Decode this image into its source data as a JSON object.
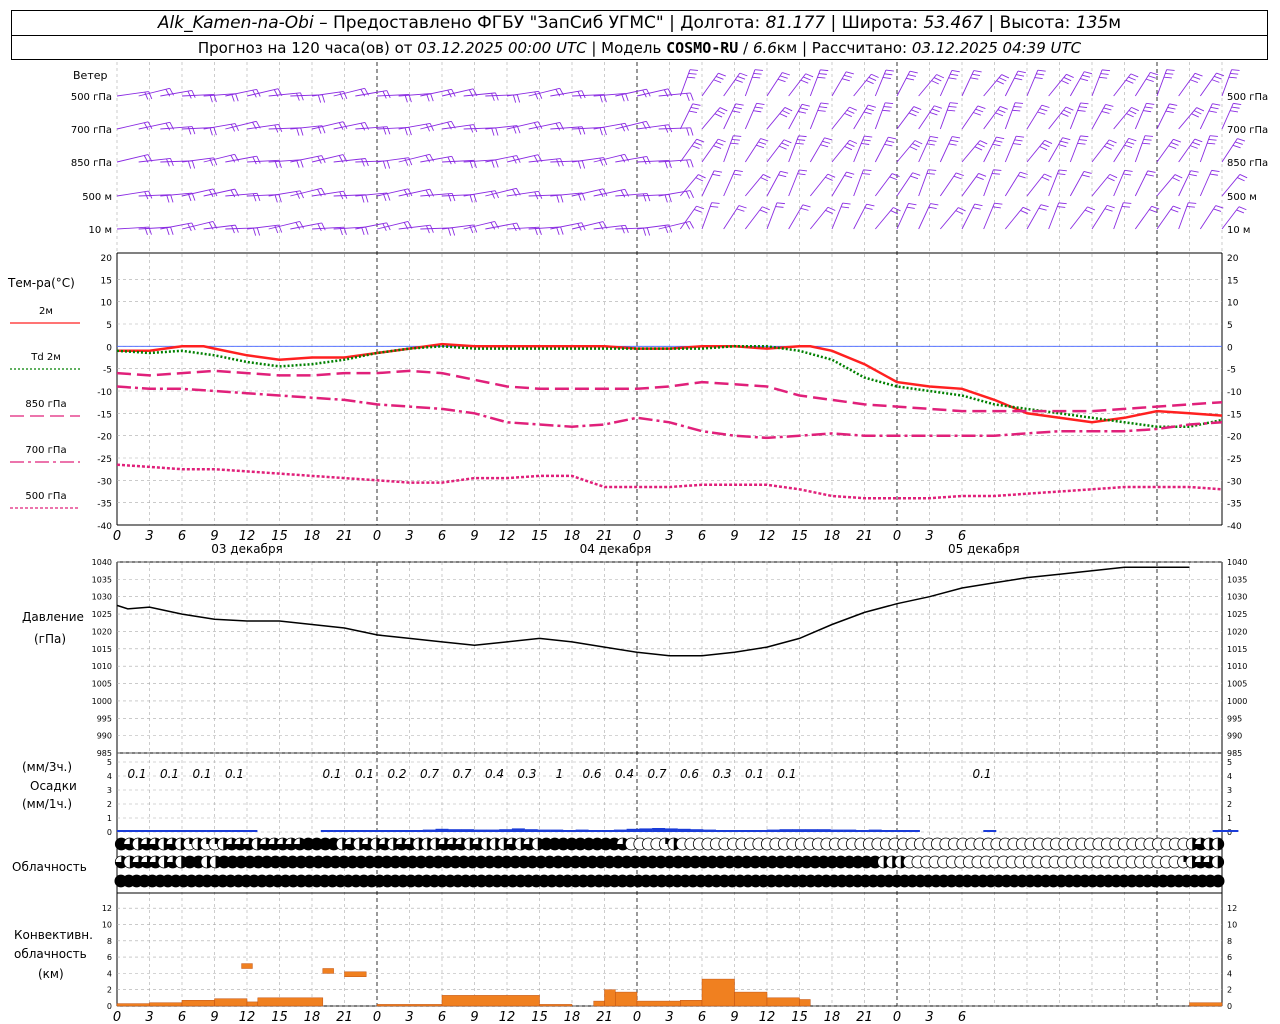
{
  "header": {
    "station": "Alk_Kamen-na-Obi",
    "provider": "– Предоставлено ФГБУ \"ЗапСиб УГМС\"",
    "lon_label": "Долгота:",
    "lon": "81.177",
    "lat_label": "Широта:",
    "lat": "53.467",
    "alt_label": "Высота:",
    "alt": "135",
    "alt_unit": "м",
    "forecast_label": "Прогноз на 120 часа(ов) от",
    "forecast_from": "03.12.2025 00:00 UTC",
    "model_label": "Модель",
    "model": "COSMO-RU",
    "model_res": "6.6",
    "model_res_unit": "км",
    "calc_label": "Рассчитано:",
    "calc_time": "03.12.2025 04:39 UTC"
  },
  "labels": {
    "wind": "Ветер",
    "temp": "Тем-ра(°C)",
    "pressure": "Давление",
    "pressure_unit": "(гПа)",
    "precip_unit_3h": "(мм/3ч.)",
    "precip": "Осадки",
    "precip_unit_1h": "(мм/1ч.)",
    "cloud": "Облачность",
    "conv1": "Конвективн.",
    "conv2": "облачность",
    "conv3": "(км)"
  },
  "chart_data": {
    "type": "meteogram",
    "x_hours": [
      0,
      3,
      6,
      9,
      12,
      15,
      18,
      21,
      24,
      27,
      30,
      33,
      36,
      39,
      42,
      45,
      48,
      51,
      54,
      57,
      60,
      63,
      66,
      69,
      72,
      75,
      78,
      81,
      84,
      87,
      90,
      93,
      96,
      99,
      102
    ],
    "x_tick_labels": [
      "0",
      "3",
      "6",
      "9",
      "12",
      "15",
      "18",
      "21",
      "0",
      "3",
      "6",
      "9",
      "12",
      "15",
      "18",
      "21",
      "0",
      "3",
      "6",
      "9",
      "12",
      "15",
      "18",
      "21",
      "0",
      "3",
      "6"
    ],
    "date_labels": [
      "03 декабря",
      "04 декабря",
      "05 декабря"
    ],
    "wind_levels": [
      "500 гПа",
      "700 гПа",
      "850 гПа",
      "500 м",
      "10 м"
    ],
    "temperature": {
      "ylim": [
        -40,
        20
      ],
      "ticks": [
        20,
        15,
        10,
        5,
        0,
        -5,
        -10,
        -15,
        -20,
        -25,
        -30,
        -35,
        -40
      ],
      "series": [
        {
          "name": "2м",
          "color": "#ff2020",
          "dash": "solid",
          "hours": [
            0,
            3,
            6,
            8,
            9,
            12,
            15,
            18,
            21,
            24,
            27,
            30,
            33,
            36,
            39,
            42,
            45,
            48,
            51,
            54,
            57,
            60,
            63,
            64,
            66,
            69,
            72,
            75,
            78,
            81,
            84,
            87,
            90,
            93,
            96,
            99,
            102
          ],
          "values": [
            -1,
            -1,
            0,
            0,
            -0.5,
            -2,
            -3,
            -2.5,
            -2.5,
            -1.5,
            -0.5,
            0.5,
            0,
            0,
            0,
            0,
            0,
            -0.5,
            -0.5,
            0,
            0,
            -0.5,
            0,
            0,
            -1,
            -4,
            -8,
            -9,
            -9.5,
            -12,
            -15,
            -16,
            -17,
            -16,
            -14.5,
            -15,
            -15.5
          ]
        },
        {
          "name": "Td 2м",
          "color": "#008000",
          "dash": "dot",
          "hours": [
            0,
            3,
            6,
            9,
            12,
            15,
            18,
            21,
            24,
            27,
            30,
            33,
            36,
            39,
            42,
            45,
            48,
            51,
            54,
            57,
            60,
            63,
            66,
            69,
            72,
            75,
            78,
            81,
            84,
            87,
            90,
            93,
            96,
            99,
            102
          ],
          "values": [
            -1,
            -1.5,
            -1,
            -2,
            -3.5,
            -4.5,
            -4,
            -3,
            -1.5,
            -0.5,
            0,
            -0.5,
            -0.5,
            -0.5,
            -0.5,
            -0.5,
            -0.5,
            -0.5,
            -0.5,
            0,
            0,
            -1,
            -3,
            -7,
            -9,
            -10,
            -11,
            -13,
            -14,
            -15,
            -16,
            -17,
            -18,
            -18,
            -16.5
          ]
        },
        {
          "name": "850 гПа",
          "color": "#e0207a",
          "dash": "longdash",
          "hours": [
            0,
            3,
            6,
            9,
            12,
            15,
            18,
            21,
            24,
            27,
            30,
            33,
            36,
            39,
            42,
            45,
            48,
            51,
            54,
            57,
            60,
            63,
            66,
            69,
            72,
            75,
            78,
            81,
            84,
            87,
            90,
            93,
            96,
            99,
            102
          ],
          "values": [
            -6,
            -6.5,
            -6,
            -5.5,
            -6,
            -6.5,
            -6.5,
            -6,
            -6,
            -5.5,
            -6,
            -7.5,
            -9,
            -9.5,
            -9.5,
            -9.5,
            -9.5,
            -9,
            -8,
            -8.5,
            -9,
            -11,
            -12,
            -13,
            -13.5,
            -14,
            -14.5,
            -14.5,
            -14.5,
            -14.5,
            -14.5,
            -14,
            -13.5,
            -13,
            -12.5
          ]
        },
        {
          "name": "700 гПа",
          "color": "#e0207a",
          "dash": "dashdot",
          "hours": [
            0,
            3,
            6,
            9,
            12,
            15,
            18,
            21,
            24,
            27,
            30,
            33,
            36,
            39,
            42,
            45,
            48,
            51,
            54,
            57,
            60,
            63,
            66,
            69,
            72,
            75,
            78,
            81,
            84,
            87,
            90,
            93,
            96,
            99,
            102
          ],
          "values": [
            -9,
            -9.5,
            -9.5,
            -10,
            -10.5,
            -11,
            -11.5,
            -12,
            -13,
            -13.5,
            -14,
            -15,
            -17,
            -17.5,
            -18,
            -17.5,
            -16,
            -17,
            -19,
            -20,
            -20.5,
            -20,
            -19.5,
            -20,
            -20,
            -20,
            -20,
            -20,
            -19.5,
            -19,
            -19,
            -19,
            -18.5,
            -17.5,
            -17
          ]
        },
        {
          "name": "500 гПа",
          "color": "#e0207a",
          "dash": "shortdash",
          "hours": [
            0,
            3,
            6,
            9,
            12,
            15,
            18,
            21,
            24,
            27,
            30,
            33,
            36,
            39,
            42,
            45,
            48,
            51,
            54,
            57,
            60,
            63,
            66,
            69,
            72,
            75,
            78,
            81,
            84,
            87,
            90,
            93,
            96,
            99,
            102
          ],
          "values": [
            -26.5,
            -27,
            -27.5,
            -27.5,
            -28,
            -28.5,
            -29,
            -29.5,
            -30,
            -30.5,
            -30.5,
            -29.5,
            -29.5,
            -29,
            -29,
            -31.5,
            -31.5,
            -31.5,
            -31,
            -31,
            -31,
            -32,
            -33.5,
            -34,
            -34,
            -34,
            -33.5,
            -33.5,
            -33,
            -32.5,
            -32,
            -31.5,
            -31.5,
            -31.5,
            -32
          ]
        }
      ]
    },
    "pressure": {
      "ylim": [
        985,
        1040
      ],
      "ticks": [
        1040,
        1035,
        1030,
        1025,
        1020,
        1015,
        1010,
        1005,
        1000,
        995,
        990,
        985
      ],
      "hours": [
        0,
        1,
        3,
        6,
        9,
        12,
        15,
        18,
        21,
        24,
        27,
        30,
        33,
        36,
        39,
        42,
        45,
        48,
        51,
        54,
        57,
        60,
        63,
        66,
        69,
        72,
        75,
        78,
        81,
        84,
        87,
        90,
        93,
        96,
        99,
        102
      ],
      "values": [
        1027.5,
        1026.5,
        1027,
        1025,
        1023.5,
        1023,
        1023,
        1022,
        1021,
        1019,
        1018,
        1017,
        1016,
        1017,
        1018,
        1017,
        1015.5,
        1014,
        1013,
        1013,
        1014,
        1015.5,
        1018,
        1022,
        1025.5,
        1028,
        1030,
        1032.5,
        1034,
        1035.5,
        1036.5,
        1037.5,
        1038.5,
        1038.5,
        1038.5
      ]
    },
    "precipitation": {
      "ylim": [
        0,
        5
      ],
      "ticks": [
        5,
        4,
        3,
        2,
        1,
        0
      ],
      "totals_3h": [
        "0.1",
        "0.1",
        "0.1",
        "0.1",
        "",
        "",
        "0.1",
        "0.1",
        "0.2",
        "0.7",
        "0.7",
        "0.4",
        "0.3",
        "1",
        "0.6",
        "0.4",
        "0.7",
        "0.6",
        "0.3",
        "0.1",
        "0.1",
        "",
        "",
        "",
        "",
        "",
        "0.1"
      ],
      "totals_hours": [
        1.5,
        4.5,
        7.5,
        10.5,
        13.5,
        16.5,
        19.5,
        22.5,
        25.5,
        28.5,
        31.5,
        34.5,
        37.5,
        40.5,
        43.5,
        46.5,
        49.5,
        52.5,
        55.5,
        58.5,
        61.5,
        64.5,
        67.5,
        70.5,
        73.5,
        76.5,
        79.5
      ],
      "hourly_mm": [
        0.1,
        0.15,
        0.2,
        0.2,
        0.2,
        0.2,
        0.2,
        0.15,
        0.1,
        0.1,
        0.05,
        0,
        0,
        0,
        0,
        0,
        0.05,
        0.1,
        0.1,
        0.15,
        0.15,
        0.15,
        0.2,
        0.25,
        0.3,
        0.4,
        0.35,
        0.35,
        0.3,
        0.3,
        0.35,
        0.45,
        0.35,
        0.3,
        0.3,
        0.25,
        0.3,
        0.25,
        0.2,
        0.3,
        0.4,
        0.45,
        0.5,
        0.45,
        0.4,
        0.35,
        0.3,
        0.25,
        0.25,
        0.25,
        0.25,
        0.3,
        0.35,
        0.35,
        0.35,
        0.35,
        0.3,
        0.3,
        0.25,
        0.3,
        0.2,
        0.05,
        0.05,
        0,
        0,
        0,
        0,
        0,
        0.05,
        0,
        0,
        0,
        0,
        0,
        0,
        0,
        0,
        0,
        0,
        0,
        0,
        0,
        0,
        0,
        0,
        0,
        0.05,
        0.05
      ]
    },
    "cloudiness": {
      "note_levels": [
        "high",
        "mid",
        "low"
      ],
      "high": [
        1,
        0.75,
        0.5,
        0.75,
        0.75,
        0.5,
        0.75,
        0.5,
        0.25,
        0.5,
        0.25,
        0.25,
        0.5,
        0.75,
        0.75,
        0.75,
        0.5,
        0.75,
        0.75,
        0.75,
        0.75,
        0.75,
        1,
        1,
        1,
        1,
        0.5,
        0.75,
        0.5,
        0.75,
        0.5,
        0.75,
        0.5,
        0.75,
        0.75,
        0.5,
        0.5,
        0.5,
        0.75,
        0.75,
        0.75,
        0.5,
        0.75,
        0.5,
        0.5,
        0.5,
        0.75,
        0.5,
        0.75,
        0.5,
        1,
        1,
        1,
        1,
        1,
        1,
        1,
        1,
        1,
        0.75,
        0,
        0,
        0,
        0,
        0.25,
        0.5,
        0,
        0,
        0,
        0,
        0,
        0,
        0,
        0,
        0,
        0,
        0,
        0,
        0,
        0,
        0,
        0,
        0,
        0,
        0,
        0,
        0,
        0,
        0,
        0,
        0,
        0,
        0,
        0,
        0,
        0,
        0,
        0,
        0,
        0,
        0,
        0,
        0,
        0,
        0,
        0,
        0,
        0,
        0,
        0,
        0,
        0,
        0,
        0,
        0,
        0,
        0,
        0,
        0,
        0,
        0,
        0,
        0,
        0,
        0,
        0,
        0.5,
        0.75,
        0.5,
        0.5
      ],
      "mid": [
        0.75,
        0.5,
        0.75,
        0.75,
        0.75,
        0.5,
        0.75,
        0.5,
        1,
        1,
        0.5,
        0.5,
        1,
        1,
        1,
        1,
        1,
        1,
        1,
        1,
        1,
        1,
        1,
        1,
        1,
        1,
        1,
        1,
        1,
        1,
        1,
        1,
        1,
        1,
        1,
        1,
        1,
        1,
        1,
        1,
        1,
        1,
        1,
        1,
        1,
        1,
        1,
        1,
        1,
        1,
        1,
        1,
        1,
        1,
        1,
        1,
        1,
        1,
        1,
        1,
        1,
        1,
        1,
        1,
        1,
        1,
        1,
        1,
        1,
        1,
        1,
        1,
        1,
        1,
        1,
        1,
        1,
        1,
        1,
        1,
        1,
        1,
        1,
        1,
        1,
        1,
        1,
        1,
        1,
        0.5,
        0.5,
        0.5,
        0,
        0,
        0,
        0,
        0,
        0,
        0,
        0,
        0,
        0,
        0,
        0,
        0,
        0,
        0,
        0,
        0,
        0,
        0,
        0,
        0,
        0,
        0,
        0,
        0,
        0,
        0,
        0,
        0,
        0,
        0,
        0,
        0.25,
        0.5,
        0.75,
        0.75,
        0.5
      ],
      "low": [
        1,
        1,
        1,
        1,
        1,
        1,
        1,
        1,
        1,
        1,
        1,
        1,
        1,
        1,
        1,
        1,
        1,
        1,
        1,
        1,
        1,
        1,
        1,
        1,
        1,
        1,
        1,
        1,
        1,
        1,
        1,
        1,
        1,
        1,
        1,
        1,
        1,
        1,
        1,
        1,
        1,
        1,
        1,
        1,
        1,
        1,
        1,
        1,
        1,
        1,
        1,
        1,
        1,
        1,
        1,
        1,
        1,
        1,
        1,
        1,
        1,
        1,
        1,
        1,
        1,
        1,
        1,
        1,
        1,
        1,
        1,
        1,
        1,
        1,
        1,
        1,
        1,
        1,
        1,
        1,
        1,
        1,
        1,
        1,
        1,
        1,
        1,
        1,
        1,
        1,
        1,
        1,
        1,
        1,
        1,
        1,
        1,
        1,
        1,
        1,
        1,
        1,
        1,
        1,
        1,
        1,
        1,
        1,
        1,
        1,
        1,
        1,
        1,
        1,
        1,
        1,
        1,
        1,
        1,
        1,
        1,
        1,
        1,
        1,
        1,
        1,
        1,
        1,
        1,
        1,
        1,
        1,
        1,
        1,
        1,
        1,
        1,
        1,
        1,
        1,
        1
      ]
    },
    "convective": {
      "ylim": [
        0,
        13
      ],
      "ticks": [
        12,
        10,
        8,
        6,
        4,
        2,
        0
      ],
      "bars": [
        {
          "h0": 0,
          "h1": 3,
          "base": 0,
          "top": 0.3
        },
        {
          "h0": 3,
          "h1": 6,
          "base": 0,
          "top": 0.4
        },
        {
          "h0": 6,
          "h1": 9,
          "base": 0,
          "top": 0.7
        },
        {
          "h0": 9,
          "h1": 12,
          "base": 0,
          "top": 0.9
        },
        {
          "h0": 12,
          "h1": 13,
          "base": 0,
          "top": 0.5
        },
        {
          "h0": 11.5,
          "h1": 12.5,
          "base": 4.6,
          "top": 5.2
        },
        {
          "h0": 13,
          "h1": 19,
          "base": 0,
          "top": 1.0
        },
        {
          "h0": 19,
          "h1": 20,
          "base": 4,
          "top": 4.6
        },
        {
          "h0": 21,
          "h1": 23,
          "base": 3.6,
          "top": 4.2
        },
        {
          "h0": 24,
          "h1": 30,
          "base": 0,
          "top": 0.2
        },
        {
          "h0": 30,
          "h1": 39,
          "base": 0,
          "top": 1.3
        },
        {
          "h0": 39,
          "h1": 42,
          "base": 0,
          "top": 0.2
        },
        {
          "h0": 44,
          "h1": 45,
          "base": 0,
          "top": 0.6
        },
        {
          "h0": 45,
          "h1": 46,
          "base": 0,
          "top": 2.0
        },
        {
          "h0": 46,
          "h1": 48,
          "base": 0,
          "top": 1.7
        },
        {
          "h0": 48,
          "h1": 52,
          "base": 0,
          "top": 0.6
        },
        {
          "h0": 52,
          "h1": 54,
          "base": 0,
          "top": 0.7
        },
        {
          "h0": 54,
          "h1": 57,
          "base": 0,
          "top": 3.3
        },
        {
          "h0": 57,
          "h1": 60,
          "base": 0,
          "top": 1.7
        },
        {
          "h0": 60,
          "h1": 63,
          "base": 0,
          "top": 1.0
        },
        {
          "h0": 63,
          "h1": 64,
          "base": 0,
          "top": 0.8
        },
        {
          "h0": 99,
          "h1": 102,
          "base": 0,
          "top": 0.4
        }
      ]
    }
  }
}
